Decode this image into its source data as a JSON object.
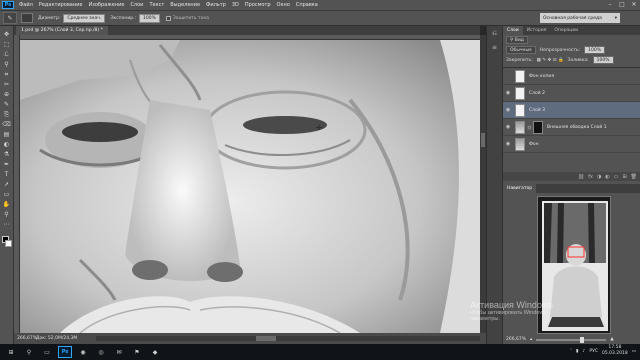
{
  "app": {
    "logo": "Ps"
  },
  "menu": [
    "Файл",
    "Редактирование",
    "Изображение",
    "Слои",
    "Текст",
    "Выделение",
    "Фильтр",
    "3D",
    "Просмотр",
    "Окно",
    "Справка"
  ],
  "window_controls": {
    "minimize": "–",
    "maximize": "□",
    "close": "✕"
  },
  "options": {
    "tool_icon": "brush-icon",
    "diameter_label": "Диаметр:",
    "diameter_value": "Среднее знач.",
    "exposure_label": "Экспонир.:",
    "exposure_value": "100%",
    "protect_tones": "Защитить тона",
    "workspace": "Основная рабочая среда"
  },
  "document": {
    "tab_title": "1.psd @ 267% (Слой 3, Сер.пр./8) *"
  },
  "status": {
    "zoom": "266,67%",
    "doc": "Док: 52,0M/24,3M"
  },
  "tools": [
    "✥",
    "⬚",
    "ℒ",
    "⚲",
    "⌗",
    "✂",
    "⊕",
    "✎",
    "⎘",
    "⌫",
    "▤",
    "◐",
    "⚗",
    "✒",
    "T",
    "➚",
    "▭",
    "✋",
    "⚲",
    "⋯"
  ],
  "layers_panel": {
    "tabs": [
      "Слои",
      "История",
      "Операции"
    ],
    "filter_label": "Вид",
    "blend_mode": "Обычные",
    "opacity_label": "Непрозрачность:",
    "opacity_value": "100%",
    "lock_label": "Закрепить:",
    "fill_label": "Заливка:",
    "fill_value": "100%",
    "layers": [
      {
        "name": "Фон копия",
        "visible": false,
        "thumb": "white",
        "selected": false,
        "mask": false
      },
      {
        "name": "Слой 2",
        "visible": true,
        "thumb": "white",
        "selected": false,
        "mask": false
      },
      {
        "name": "Слой 3",
        "visible": true,
        "thumb": "white",
        "selected": true,
        "mask": false
      },
      {
        "name": "Внешняя обводка Слой 1",
        "visible": true,
        "thumb": "gray",
        "selected": false,
        "mask": true
      },
      {
        "name": "Фон",
        "visible": true,
        "thumb": "gray",
        "selected": false,
        "mask": false
      }
    ],
    "bottom_icons": [
      "⛓",
      "fx",
      "◑",
      "◐",
      "▭",
      "⊞",
      "🗑"
    ]
  },
  "navigator": {
    "tab": "Навигатор",
    "zoom": "266,67%"
  },
  "watermark": {
    "line1": "Активация Windows",
    "line2": "Чтобы активировать Windows,",
    "line3": "параметры."
  },
  "taskbar": {
    "apps": [
      "⊞",
      "⚲",
      "▭",
      "Ps",
      "◉",
      "◎",
      "✉",
      "⚑",
      "◆"
    ],
    "lang": "РУС",
    "time": "17:58",
    "date": "05.03.2018"
  }
}
